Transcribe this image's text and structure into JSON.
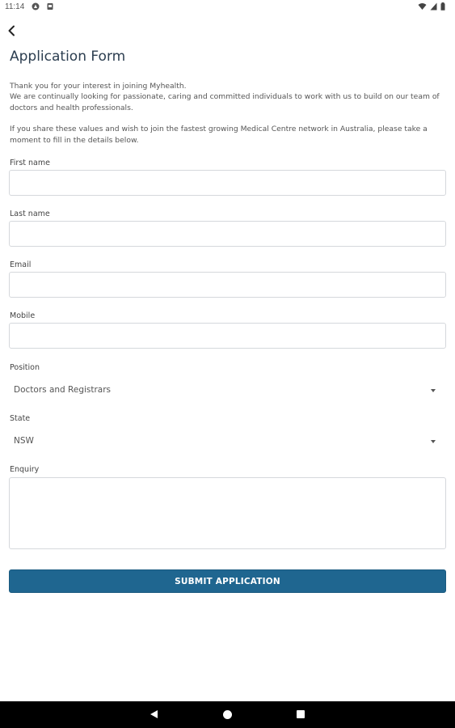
{
  "status_bar": {
    "time": "11:14",
    "icons_left": [
      "app-notification-icon",
      "sd-card-icon"
    ],
    "icons_right": [
      "wifi-icon",
      "signal-icon",
      "battery-icon"
    ]
  },
  "header": {
    "back_icon": "arrow-back-icon",
    "title": "Application Form"
  },
  "intro": {
    "paragraph1": "Thank you for your interest in joining Myhealth.\nWe are continually looking for passionate, caring and committed individuals to work with us to build on our team of doctors and health professionals.",
    "paragraph2": "If you share these values and wish to join the fastest growing Medical Centre network in Australia, please take a moment to fill in the details below."
  },
  "form": {
    "first_name": {
      "label": "First name",
      "value": "",
      "placeholder": ""
    },
    "last_name": {
      "label": "Last name",
      "value": "",
      "placeholder": ""
    },
    "email": {
      "label": "Email",
      "value": "",
      "placeholder": ""
    },
    "mobile": {
      "label": "Mobile",
      "value": "",
      "placeholder": ""
    },
    "position": {
      "label": "Position",
      "selected": "Doctors and Registrars"
    },
    "state": {
      "label": "State",
      "selected": "NSW"
    },
    "enquiry": {
      "label": "Enquiry",
      "value": "",
      "placeholder": ""
    },
    "submit_label": "SUBMIT APPLICATION"
  },
  "colors": {
    "primary_button": "#1f6690",
    "title_text": "#2c3e50",
    "field_border": "#d5d8dc",
    "nav_bar": "#000000"
  },
  "nav_bar": {
    "icons": [
      "nav-back-icon",
      "nav-home-icon",
      "nav-recents-icon"
    ]
  }
}
